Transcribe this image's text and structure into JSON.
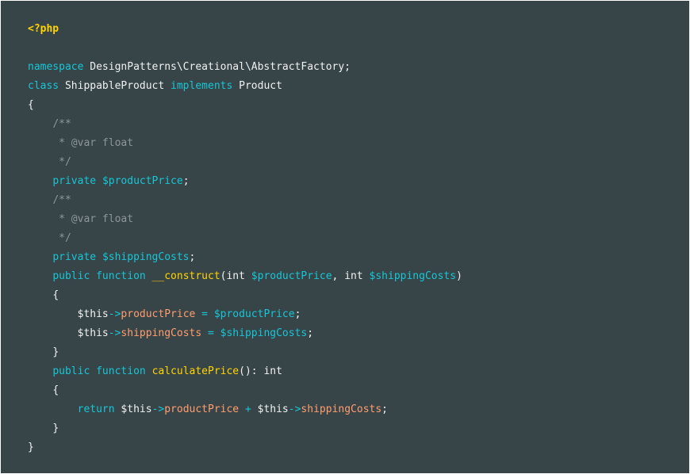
{
  "code": {
    "open_tag": "<?php",
    "namespace_kw": "namespace",
    "namespace_name": "DesignPatterns\\Creational\\AbstractFactory;",
    "class_kw": "class",
    "class_name": "ShippableProduct",
    "implements_kw": "implements",
    "interface_name": "Product",
    "open_brace": "{",
    "close_brace": "}",
    "doc_open": "/**",
    "doc_var": " * @var float",
    "doc_close": " */",
    "private_kw": "private",
    "public_kw": "public",
    "function_kw": "function",
    "return_kw": "return",
    "int_kw": "int",
    "this_var": "$this",
    "arrow": "->",
    "var_product_price": "$productPrice",
    "var_shipping_costs": "$shippingCosts",
    "prop_product_price": "productPrice",
    "prop_shipping_costs": "shippingCosts",
    "construct_fn": "__construct",
    "calculate_fn": "calculatePrice",
    "semicolon": ";",
    "comma": ", ",
    "equals": " = ",
    "plus": " + ",
    "paren_open": "(",
    "paren_close": ")",
    "empty_parens_return": "(): "
  }
}
